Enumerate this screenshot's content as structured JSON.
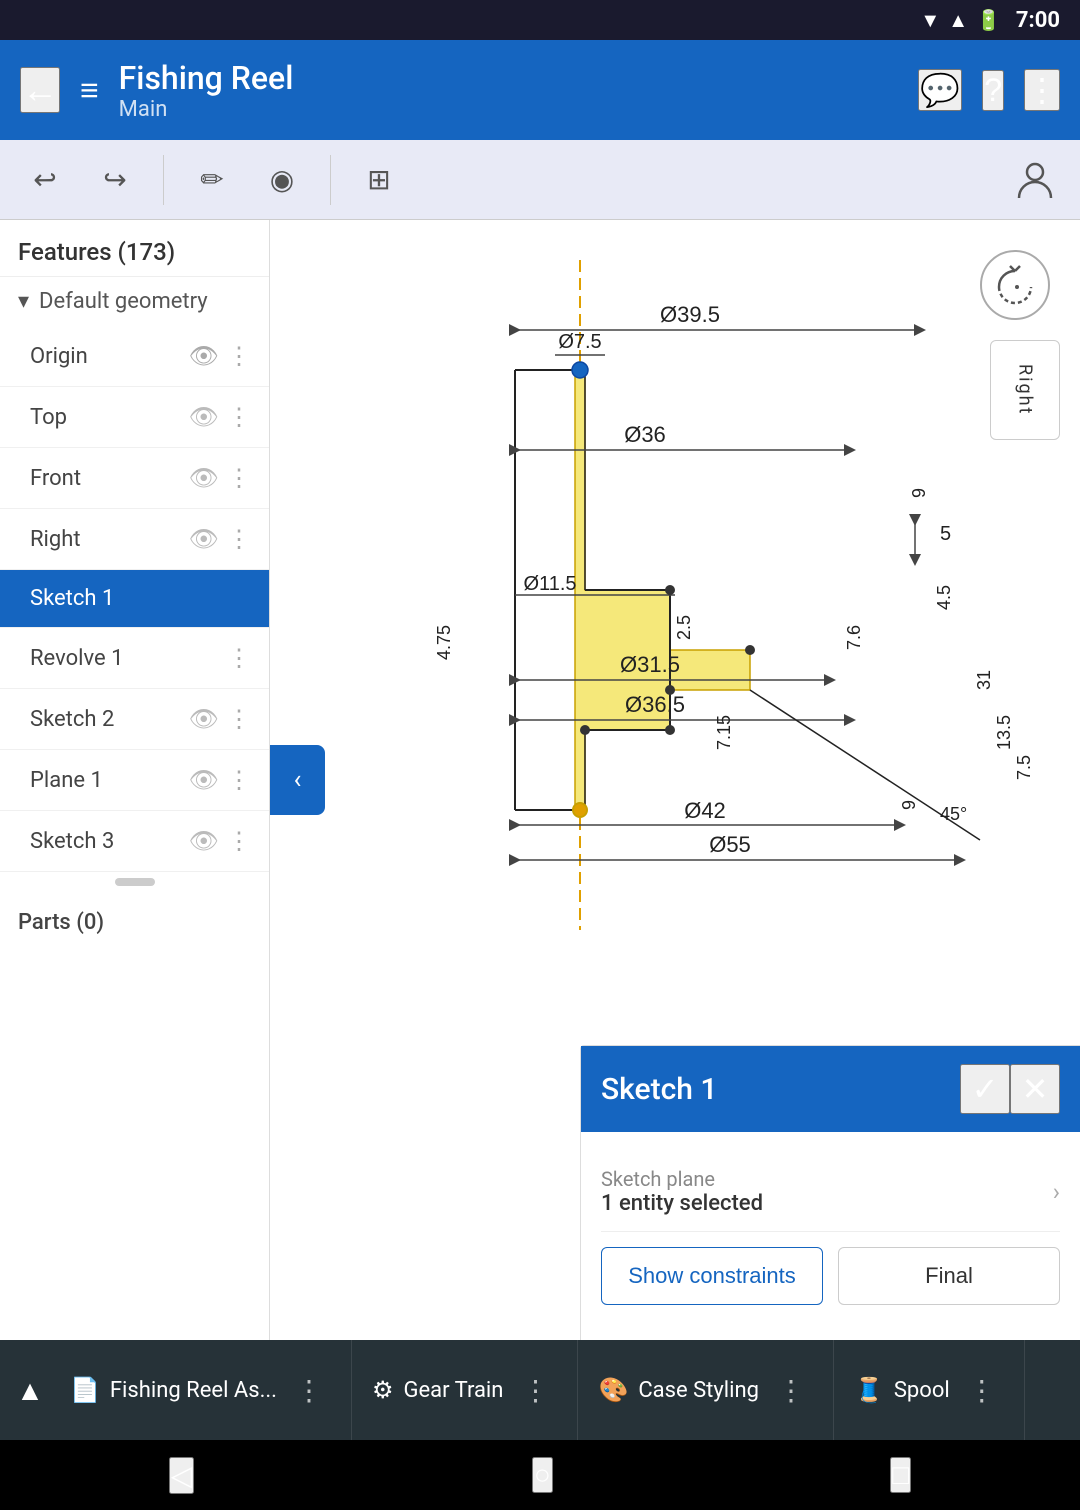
{
  "statusBar": {
    "time": "7:00",
    "icons": [
      "wifi",
      "signal",
      "battery"
    ]
  },
  "topbar": {
    "backLabel": "←",
    "title": "Fishing Reel",
    "subtitle": "Main",
    "icons": {
      "project": "≡",
      "help": "?",
      "more": "⋮"
    }
  },
  "toolbar": {
    "undo": "↩",
    "redo": "↪",
    "pencil": "✏",
    "globe": "◉",
    "dimensions": "⊞",
    "person": "👤"
  },
  "sidebar": {
    "header": "Features (173)",
    "section": "Default geometry",
    "items": [
      {
        "label": "Origin",
        "hasEye": true,
        "hasMore": true,
        "active": false
      },
      {
        "label": "Top",
        "hasEye": true,
        "hasMore": true,
        "active": false
      },
      {
        "label": "Front",
        "hasEye": true,
        "hasMore": true,
        "active": false
      },
      {
        "label": "Right",
        "hasEye": true,
        "hasMore": true,
        "active": false
      },
      {
        "label": "Sketch 1",
        "hasEye": false,
        "hasMore": false,
        "active": true
      },
      {
        "label": "Revolve 1",
        "hasEye": false,
        "hasMore": true,
        "active": false
      },
      {
        "label": "Sketch 2",
        "hasEye": true,
        "hasMore": true,
        "active": false
      },
      {
        "label": "Plane 1",
        "hasEye": true,
        "hasMore": true,
        "active": false
      },
      {
        "label": "Sketch 3",
        "hasEye": true,
        "hasMore": true,
        "active": false
      }
    ],
    "parts": "Parts (0)"
  },
  "canvas": {
    "rotateIcon": "↻",
    "rightLabel": "Right",
    "collapseIcon": "‹"
  },
  "drawing": {
    "dimensions": {
      "d39_5": "Ø39.5",
      "d7_5": "Ø7.5",
      "d36": "Ø36",
      "d11_5": "Ø11.5",
      "d31_5": "Ø31.5",
      "d36_5": "Ø36.5",
      "d42": "Ø42",
      "d55": "Ø55",
      "dim5": "5",
      "dim4_75": "4.75",
      "dim2_5": "2.5",
      "dim7_6": "7.6",
      "dim4_5": "4.5",
      "dim31": "31",
      "dim13_5": "13.5",
      "dim7_5": "7.5",
      "dim7_15": "7.15",
      "dim9top": "9",
      "dim9bot": "9",
      "dim45": "45°"
    }
  },
  "bottomPanel": {
    "title": "Sketch 1",
    "confirmIcon": "✓",
    "closeIcon": "✕",
    "sketchPlane": {
      "label": "Sketch plane",
      "value": "1 entity selected",
      "arrowIcon": "›"
    },
    "showConstraintsBtn": "Show constraints",
    "finalBtn": "Final"
  },
  "bottomTabs": {
    "upIcon": "▲",
    "tabs": [
      {
        "icon": "📄",
        "label": "Fishing Reel As...",
        "more": "⋮"
      },
      {
        "icon": "⚙",
        "label": "Gear Train",
        "more": "⋮"
      },
      {
        "icon": "🎨",
        "label": "Case Styling",
        "more": "⋮"
      },
      {
        "icon": "🧵",
        "label": "Spool",
        "more": "⋮"
      }
    ]
  },
  "navBar": {
    "backIcon": "◁",
    "homeIcon": "○",
    "squareIcon": "□"
  }
}
